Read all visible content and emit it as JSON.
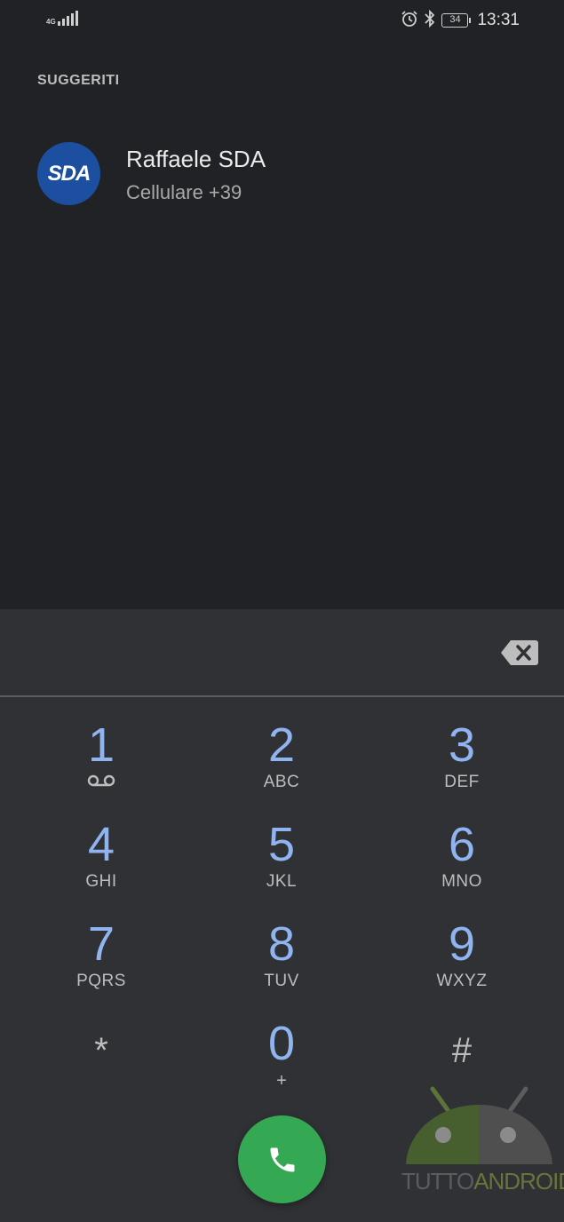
{
  "status_bar": {
    "network": "4G",
    "time": "13:31",
    "battery": "34",
    "icons": [
      "signal-icon",
      "alarm-icon",
      "bluetooth-icon",
      "battery-icon"
    ]
  },
  "suggestions": {
    "title": "SUGGERITI",
    "items": [
      {
        "avatar_text": "SDA",
        "name": "Raffaele SDA",
        "detail": "Cellulare +39",
        "avatar_color": "#1c4fa0"
      }
    ]
  },
  "dialpad": {
    "input_value": "",
    "keys": [
      {
        "digit": "1",
        "letters": "",
        "icon": "voicemail-icon"
      },
      {
        "digit": "2",
        "letters": "ABC"
      },
      {
        "digit": "3",
        "letters": "DEF"
      },
      {
        "digit": "4",
        "letters": "GHI"
      },
      {
        "digit": "5",
        "letters": "JKL"
      },
      {
        "digit": "6",
        "letters": "MNO"
      },
      {
        "digit": "7",
        "letters": "PQRS"
      },
      {
        "digit": "8",
        "letters": "TUV"
      },
      {
        "digit": "9",
        "letters": "WXYZ"
      },
      {
        "digit": "*",
        "letters": ""
      },
      {
        "digit": "0",
        "letters": "+"
      },
      {
        "digit": "#",
        "letters": ""
      }
    ],
    "call_button_color": "#34a853",
    "digit_color": "#8fb4ef"
  },
  "watermark": {
    "part1": "TUTTO",
    "part2": "ANDROID"
  }
}
